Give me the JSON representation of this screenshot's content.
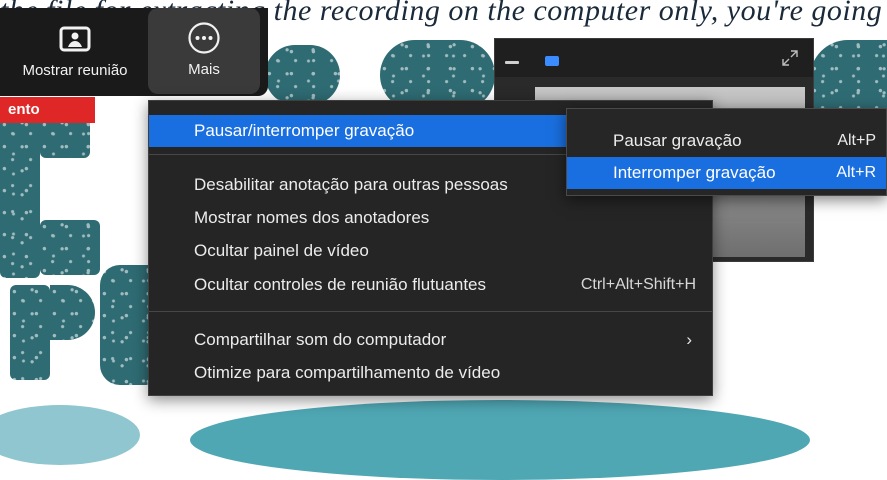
{
  "background": {
    "caption": "the file for extracting the recording on the computer only, you're going to get to"
  },
  "toolbar": {
    "show_meeting_label": "Mostrar reunião",
    "more_label": "Mais",
    "recording_badge": "ento"
  },
  "menu": {
    "items": [
      {
        "label": "Pausar/interromper gravação",
        "shortcut": ""
      },
      {
        "label": "Desabilitar anotação para outras pessoas",
        "shortcut": ""
      },
      {
        "label": "Mostrar nomes dos anotadores",
        "shortcut": ""
      },
      {
        "label": "Ocultar painel de vídeo",
        "shortcut": ""
      },
      {
        "label": "Ocultar controles de reunião flutuantes",
        "shortcut": "Ctrl+Alt+Shift+H"
      },
      {
        "label": "Compartilhar som do computador",
        "shortcut": ""
      },
      {
        "label": "Otimize para compartilhamento de vídeo",
        "shortcut": ""
      }
    ]
  },
  "submenu": {
    "items": [
      {
        "label": "Pausar gravação",
        "shortcut": "Alt+P"
      },
      {
        "label": "Interromper gravação",
        "shortcut": "Alt+R"
      }
    ]
  },
  "colors": {
    "highlight": "#1a6fe0",
    "menu_bg": "#252525",
    "recording_red": "#e02727",
    "teal_decor": "#2f6b73"
  },
  "icons": [
    "share-screen-icon",
    "more-options-icon",
    "minimize-icon",
    "camera-icon",
    "expand-icon",
    "chevron-right-icon"
  ]
}
